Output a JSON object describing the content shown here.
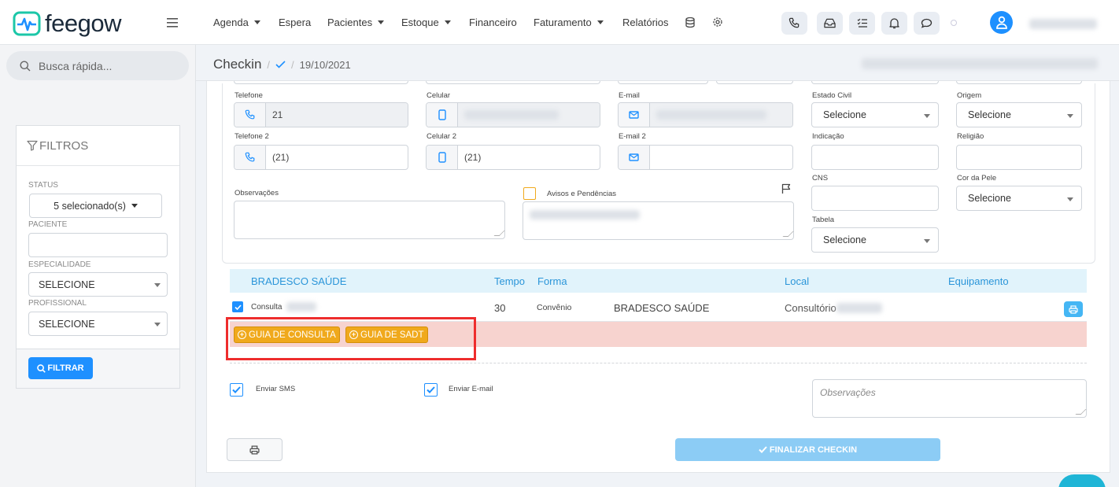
{
  "brand": {
    "name": "feegow",
    "primary": "#1e90ff",
    "accent_orange": "#f0a91c",
    "header_blue": "#2a95d9"
  },
  "nav": {
    "items": [
      {
        "label": "Agenda",
        "dropdown": true
      },
      {
        "label": "Espera",
        "dropdown": false
      },
      {
        "label": "Pacientes",
        "dropdown": true
      },
      {
        "label": "Estoque",
        "dropdown": true
      },
      {
        "label": "Financeiro",
        "dropdown": false
      },
      {
        "label": "Faturamento",
        "dropdown": true
      },
      {
        "label": "Relatórios",
        "dropdown": false
      }
    ],
    "icons": [
      "database-icon",
      "gear-icon"
    ],
    "toolbar_icons": [
      "phone-icon",
      "inbox-icon",
      "task-list-icon",
      "bell-icon",
      "chat-icon"
    ]
  },
  "sidebar": {
    "search_placeholder": "Busca rápida...",
    "filters_title": "FILTROS",
    "status_label": "STATUS",
    "status_value": "5 selecionado(s)",
    "paciente_label": "PACIENTE",
    "especialidade_label": "ESPECIALIDADE",
    "especialidade_value": "SELECIONE",
    "profissional_label": "PROFISSIONAL",
    "profissional_value": "SELECIONE",
    "filtrar_label": "FILTRAR"
  },
  "breadcrumb": {
    "title": "Checkin",
    "separator": "/",
    "date": "19/10/2021"
  },
  "form": {
    "telefone_label": "Telefone",
    "telefone_value": "21",
    "celular_label": "Celular",
    "email_label": "E-mail",
    "telefone2_label": "Telefone 2",
    "telefone2_value": "(21)",
    "celular2_label": "Celular 2",
    "celular2_value": "(21)",
    "email2_label": "E-mail 2",
    "observacoes_label": "Observações",
    "avisos_label": "Avisos e Pendências",
    "estado_civil_label": "Estado Civil",
    "estado_civil_value": "Selecione",
    "origem_label": "Origem",
    "origem_value": "Selecione",
    "indicacao_label": "Indicação",
    "religiao_label": "Religião",
    "cns_label": "CNS",
    "cor_pele_label": "Cor da Pele",
    "cor_pele_value": "Selecione",
    "tabela_label": "Tabela",
    "tabela_value": "Selecione"
  },
  "procedures": {
    "header": {
      "convenio": "BRADESCO SAÚDE",
      "tempo": "Tempo",
      "forma": "Forma",
      "local": "Local",
      "equipamento": "Equipamento"
    },
    "row": {
      "procedimento": "Consulta",
      "tempo": "30",
      "forma": "Convênio",
      "convenio": "BRADESCO SAÚDE",
      "local": "Consultório"
    },
    "guia_consulta_label": "GUIA DE CONSULTA",
    "guia_sadt_label": "GUIA DE SADT"
  },
  "footer": {
    "enviar_sms_label": "Enviar SMS",
    "enviar_email_label": "Enviar E-mail",
    "observacoes_placeholder": "Observações",
    "finalizar_label": "FINALIZAR CHECKIN"
  }
}
